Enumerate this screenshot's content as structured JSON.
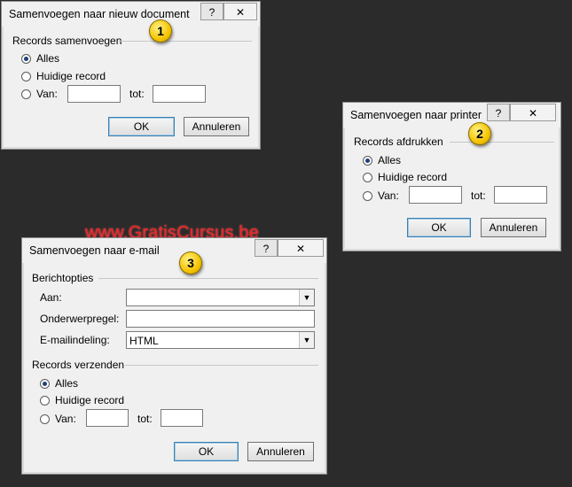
{
  "watermark": "www.GratisCursus.be",
  "dialog1": {
    "title": "Samenvoegen naar nieuw document",
    "help_label": "?",
    "close_label": "✕",
    "badge": "1",
    "group_label": "Records samenvoegen",
    "radio_all": "Alles",
    "radio_current": "Huidige record",
    "radio_from": "Van:",
    "to_label": "tot:",
    "from_value": "",
    "to_value": "",
    "ok_label": "OK",
    "cancel_label": "Annuleren"
  },
  "dialog2": {
    "title": "Samenvoegen naar printer",
    "help_label": "?",
    "close_label": "✕",
    "badge": "2",
    "group_label": "Records afdrukken",
    "radio_all": "Alles",
    "radio_current": "Huidige record",
    "radio_from": "Van:",
    "to_label": "tot:",
    "from_value": "",
    "to_value": "",
    "ok_label": "OK",
    "cancel_label": "Annuleren"
  },
  "dialog3": {
    "title": "Samenvoegen naar e-mail",
    "help_label": "?",
    "close_label": "✕",
    "badge": "3",
    "group1_label": "Berichtopties",
    "to_field_label": "Aan:",
    "to_field_value": "",
    "subject_label": "Onderwerpregel:",
    "subject_value": "",
    "format_label": "E-mailindeling:",
    "format_value": "HTML",
    "group2_label": "Records verzenden",
    "radio_all": "Alles",
    "radio_current": "Huidige record",
    "radio_from": "Van:",
    "to_label": "tot:",
    "from_value": "",
    "to_value": "",
    "ok_label": "OK",
    "cancel_label": "Annuleren"
  },
  "colors": {
    "background": "#2b2b2b",
    "dialog_bg": "#f0f0f0",
    "watermark": "#e8282b",
    "badge": "#f5c400"
  }
}
